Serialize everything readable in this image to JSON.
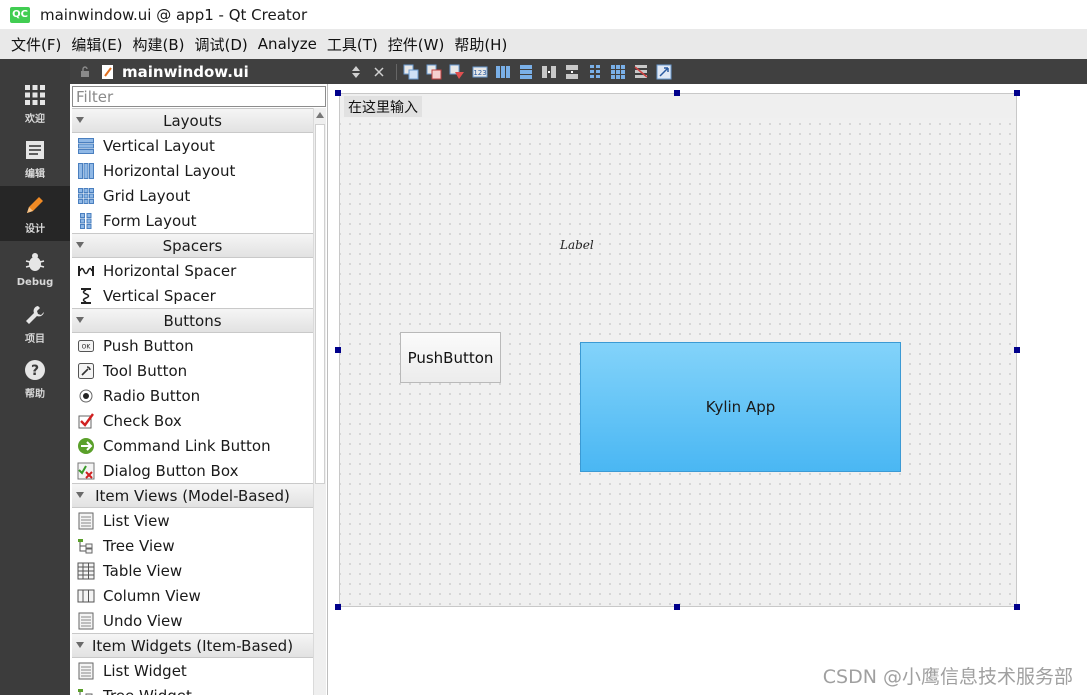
{
  "window": {
    "title": "mainwindow.ui @ app1 - Qt Creator",
    "logo": "QC"
  },
  "menubar": {
    "items": [
      "文件(F)",
      "编辑(E)",
      "构建(B)",
      "调试(D)",
      "Analyze",
      "工具(T)",
      "控件(W)",
      "帮助(H)"
    ]
  },
  "modes": [
    {
      "label": "欢迎",
      "icon": "grid-icon"
    },
    {
      "label": "编辑",
      "icon": "document-icon"
    },
    {
      "label": "设计",
      "icon": "pencil-icon"
    },
    {
      "label": "Debug",
      "icon": "bug-icon"
    },
    {
      "label": "项目",
      "icon": "wrench-icon"
    },
    {
      "label": "帮助",
      "icon": "help-icon"
    }
  ],
  "editor": {
    "doc_title": "mainwindow.ui"
  },
  "widgetbox": {
    "filter_placeholder": "Filter",
    "categories": [
      {
        "label": "Layouts",
        "items": [
          "Vertical Layout",
          "Horizontal Layout",
          "Grid Layout",
          "Form Layout"
        ]
      },
      {
        "label": "Spacers",
        "items": [
          "Horizontal Spacer",
          "Vertical Spacer"
        ]
      },
      {
        "label": "Buttons",
        "items": [
          "Push Button",
          "Tool Button",
          "Radio Button",
          "Check Box",
          "Command Link Button",
          "Dialog Button Box"
        ]
      },
      {
        "label": "Item Views (Model-Based)",
        "items": [
          "List View",
          "Tree View",
          "Table View",
          "Column View",
          "Undo View"
        ]
      },
      {
        "label": "Item Widgets (Item-Based)",
        "items": [
          "List Widget",
          "Tree Widget"
        ]
      }
    ]
  },
  "form": {
    "menu_placeholder": "在这里输入",
    "label_text": "Label",
    "push_button_text": "PushButton",
    "kylin_button_text": "Kylin App"
  },
  "colors": {
    "handle": "#00008b",
    "kylin_top": "#83d3fa",
    "kylin_bottom": "#4ab7f3",
    "modebar": "#3c3c3c"
  },
  "watermark": "CSDN @小鹰信息技术服务部"
}
